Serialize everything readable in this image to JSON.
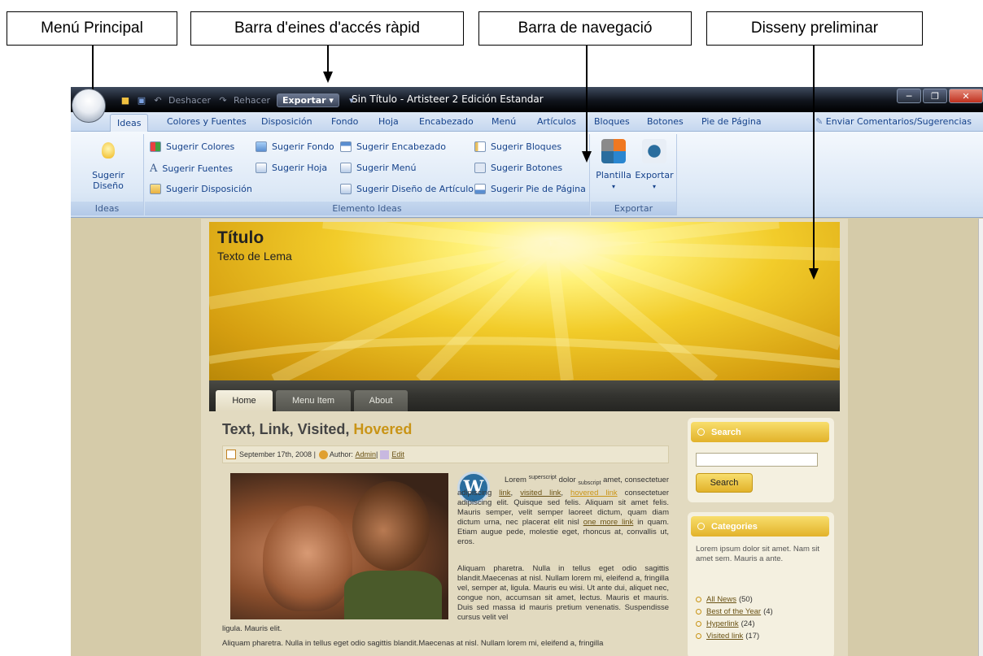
{
  "callouts": {
    "menu": "Menú Principal",
    "qat": "Barra d'eines d'accés ràpid",
    "nav": "Barra de navegació",
    "design": "Disseny preliminar"
  },
  "window": {
    "title": "Sin Título - Artisteer 2 Edición Estandar"
  },
  "qat": {
    "undo": "Deshacer",
    "redo": "Rehacer",
    "export": "Exportar"
  },
  "tabs": [
    "Ideas",
    "Colores y Fuentes",
    "Disposición",
    "Fondo",
    "Hoja",
    "Encabezado",
    "Menú",
    "Artículos",
    "Bloques",
    "Botones",
    "Pie de Página"
  ],
  "feedback": "Enviar Comentarios/Sugerencias",
  "ribbon": {
    "suggest_design": "Sugerir Diseño",
    "group_ideas": "Ideas",
    "group_elements": "Elemento Ideas",
    "group_export": "Exportar",
    "items": [
      "Sugerir Colores",
      "Sugerir Fuentes",
      "Sugerir Disposición",
      "Sugerir Fondo",
      "Sugerir Hoja",
      "Sugerir Encabezado",
      "Sugerir Menú",
      "Sugerir Diseño de Artículo",
      "Sugerir Bloques",
      "Sugerir Botones",
      "Sugerir Pie de Página"
    ],
    "template": "Plantilla",
    "export": "Exportar"
  },
  "site": {
    "title": "Título",
    "slogan": "Texto de Lema",
    "nav": [
      "Home",
      "Menu Item",
      "About"
    ],
    "post": {
      "title_main": "Text, Link, Visited, ",
      "title_hover": "Hovered",
      "date": "September 17th, 2008 |",
      "author_label": " Author:",
      "author": "Admin",
      "sep": " | ",
      "edit": "Edit",
      "p1_a": "Lorem ",
      "sup": "superscript",
      "p1_b": " dolor ",
      "sub": "subscript",
      "p1_c": " amet, consectetuer adipiscing ",
      "link": "link",
      "comma": ", ",
      "visited": "visited link",
      "comma2": ", ",
      "hovered": "hovered link",
      "p1_d": " consectetuer adipiscing elit. Quisque sed felis. Aliquam sit amet felis. Mauris semper, velit semper laoreet dictum, quam diam dictum urna, nec placerat elit nisl ",
      "more": "one more link",
      "p1_e": " in quam. Etiam augue pede, molestie eget, rhoncus at, convallis ut, eros.",
      "p2": "Aliquam pharetra. Nulla in tellus eget odio sagittis blandit.Maecenas at nisl. Nullam lorem mi, eleifend a, fringilla vel, semper at, ligula. Mauris eu wisi. Ut ante dui, aliquet nec, congue non, accumsan sit amet, lectus. Mauris et mauris. Duis sed massa id mauris pretium venenatis. Suspendisse cursus velit vel",
      "p2_end": "ligula. Mauris elit.",
      "p3": "Aliquam pharetra. Nulla in tellus eget odio sagittis blandit.Maecenas at nisl. Nullam lorem mi, eleifend a, fringilla"
    },
    "search": {
      "title": "Search",
      "button": "Search"
    },
    "categories": {
      "title": "Categories",
      "text": "Lorem ipsum dolor sit amet. Nam sit amet sem. Mauris a ante.",
      "items": [
        {
          "label": "All News",
          "count": "(50)"
        },
        {
          "label": "Best of the Year",
          "count": "(4)"
        },
        {
          "label": "Hyperlink",
          "count": "(24)"
        },
        {
          "label": "Visited link",
          "count": "(17)"
        }
      ]
    }
  }
}
